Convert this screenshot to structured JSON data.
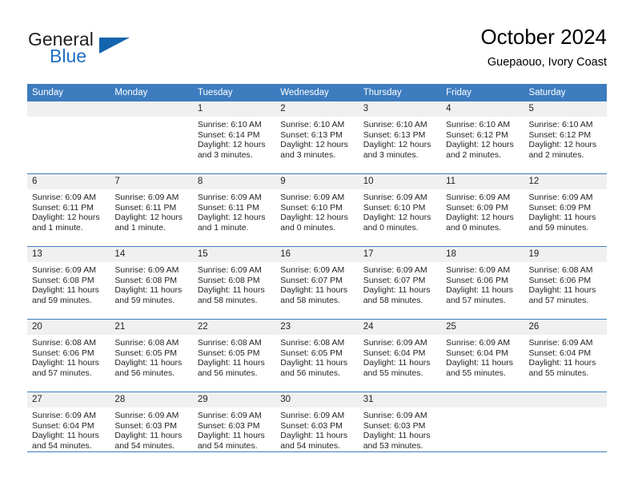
{
  "brand": {
    "line1": "General",
    "line2": "Blue",
    "logo_icon": "triangle-logo-icon",
    "color_dark": "#231f20",
    "color_blue": "#1f6fc4"
  },
  "header": {
    "title": "October 2024",
    "subtitle": "Guepaouo, Ivory Coast"
  },
  "colors": {
    "header_blue": "#3c7cbf",
    "daynum_band": "#f0f0f0",
    "text": "#231f20"
  },
  "weekday_headers": [
    "Sunday",
    "Monday",
    "Tuesday",
    "Wednesday",
    "Thursday",
    "Friday",
    "Saturday"
  ],
  "weeks": [
    [
      {
        "day": "",
        "sunrise": "",
        "sunset": "",
        "daylight1": "",
        "daylight2": ""
      },
      {
        "day": "",
        "sunrise": "",
        "sunset": "",
        "daylight1": "",
        "daylight2": ""
      },
      {
        "day": "1",
        "sunrise": "Sunrise: 6:10 AM",
        "sunset": "Sunset: 6:14 PM",
        "daylight1": "Daylight: 12 hours",
        "daylight2": "and 3 minutes."
      },
      {
        "day": "2",
        "sunrise": "Sunrise: 6:10 AM",
        "sunset": "Sunset: 6:13 PM",
        "daylight1": "Daylight: 12 hours",
        "daylight2": "and 3 minutes."
      },
      {
        "day": "3",
        "sunrise": "Sunrise: 6:10 AM",
        "sunset": "Sunset: 6:13 PM",
        "daylight1": "Daylight: 12 hours",
        "daylight2": "and 3 minutes."
      },
      {
        "day": "4",
        "sunrise": "Sunrise: 6:10 AM",
        "sunset": "Sunset: 6:12 PM",
        "daylight1": "Daylight: 12 hours",
        "daylight2": "and 2 minutes."
      },
      {
        "day": "5",
        "sunrise": "Sunrise: 6:10 AM",
        "sunset": "Sunset: 6:12 PM",
        "daylight1": "Daylight: 12 hours",
        "daylight2": "and 2 minutes."
      }
    ],
    [
      {
        "day": "6",
        "sunrise": "Sunrise: 6:09 AM",
        "sunset": "Sunset: 6:11 PM",
        "daylight1": "Daylight: 12 hours",
        "daylight2": "and 1 minute."
      },
      {
        "day": "7",
        "sunrise": "Sunrise: 6:09 AM",
        "sunset": "Sunset: 6:11 PM",
        "daylight1": "Daylight: 12 hours",
        "daylight2": "and 1 minute."
      },
      {
        "day": "8",
        "sunrise": "Sunrise: 6:09 AM",
        "sunset": "Sunset: 6:11 PM",
        "daylight1": "Daylight: 12 hours",
        "daylight2": "and 1 minute."
      },
      {
        "day": "9",
        "sunrise": "Sunrise: 6:09 AM",
        "sunset": "Sunset: 6:10 PM",
        "daylight1": "Daylight: 12 hours",
        "daylight2": "and 0 minutes."
      },
      {
        "day": "10",
        "sunrise": "Sunrise: 6:09 AM",
        "sunset": "Sunset: 6:10 PM",
        "daylight1": "Daylight: 12 hours",
        "daylight2": "and 0 minutes."
      },
      {
        "day": "11",
        "sunrise": "Sunrise: 6:09 AM",
        "sunset": "Sunset: 6:09 PM",
        "daylight1": "Daylight: 12 hours",
        "daylight2": "and 0 minutes."
      },
      {
        "day": "12",
        "sunrise": "Sunrise: 6:09 AM",
        "sunset": "Sunset: 6:09 PM",
        "daylight1": "Daylight: 11 hours",
        "daylight2": "and 59 minutes."
      }
    ],
    [
      {
        "day": "13",
        "sunrise": "Sunrise: 6:09 AM",
        "sunset": "Sunset: 6:08 PM",
        "daylight1": "Daylight: 11 hours",
        "daylight2": "and 59 minutes."
      },
      {
        "day": "14",
        "sunrise": "Sunrise: 6:09 AM",
        "sunset": "Sunset: 6:08 PM",
        "daylight1": "Daylight: 11 hours",
        "daylight2": "and 59 minutes."
      },
      {
        "day": "15",
        "sunrise": "Sunrise: 6:09 AM",
        "sunset": "Sunset: 6:08 PM",
        "daylight1": "Daylight: 11 hours",
        "daylight2": "and 58 minutes."
      },
      {
        "day": "16",
        "sunrise": "Sunrise: 6:09 AM",
        "sunset": "Sunset: 6:07 PM",
        "daylight1": "Daylight: 11 hours",
        "daylight2": "and 58 minutes."
      },
      {
        "day": "17",
        "sunrise": "Sunrise: 6:09 AM",
        "sunset": "Sunset: 6:07 PM",
        "daylight1": "Daylight: 11 hours",
        "daylight2": "and 58 minutes."
      },
      {
        "day": "18",
        "sunrise": "Sunrise: 6:09 AM",
        "sunset": "Sunset: 6:06 PM",
        "daylight1": "Daylight: 11 hours",
        "daylight2": "and 57 minutes."
      },
      {
        "day": "19",
        "sunrise": "Sunrise: 6:08 AM",
        "sunset": "Sunset: 6:06 PM",
        "daylight1": "Daylight: 11 hours",
        "daylight2": "and 57 minutes."
      }
    ],
    [
      {
        "day": "20",
        "sunrise": "Sunrise: 6:08 AM",
        "sunset": "Sunset: 6:06 PM",
        "daylight1": "Daylight: 11 hours",
        "daylight2": "and 57 minutes."
      },
      {
        "day": "21",
        "sunrise": "Sunrise: 6:08 AM",
        "sunset": "Sunset: 6:05 PM",
        "daylight1": "Daylight: 11 hours",
        "daylight2": "and 56 minutes."
      },
      {
        "day": "22",
        "sunrise": "Sunrise: 6:08 AM",
        "sunset": "Sunset: 6:05 PM",
        "daylight1": "Daylight: 11 hours",
        "daylight2": "and 56 minutes."
      },
      {
        "day": "23",
        "sunrise": "Sunrise: 6:08 AM",
        "sunset": "Sunset: 6:05 PM",
        "daylight1": "Daylight: 11 hours",
        "daylight2": "and 56 minutes."
      },
      {
        "day": "24",
        "sunrise": "Sunrise: 6:09 AM",
        "sunset": "Sunset: 6:04 PM",
        "daylight1": "Daylight: 11 hours",
        "daylight2": "and 55 minutes."
      },
      {
        "day": "25",
        "sunrise": "Sunrise: 6:09 AM",
        "sunset": "Sunset: 6:04 PM",
        "daylight1": "Daylight: 11 hours",
        "daylight2": "and 55 minutes."
      },
      {
        "day": "26",
        "sunrise": "Sunrise: 6:09 AM",
        "sunset": "Sunset: 6:04 PM",
        "daylight1": "Daylight: 11 hours",
        "daylight2": "and 55 minutes."
      }
    ],
    [
      {
        "day": "27",
        "sunrise": "Sunrise: 6:09 AM",
        "sunset": "Sunset: 6:04 PM",
        "daylight1": "Daylight: 11 hours",
        "daylight2": "and 54 minutes."
      },
      {
        "day": "28",
        "sunrise": "Sunrise: 6:09 AM",
        "sunset": "Sunset: 6:03 PM",
        "daylight1": "Daylight: 11 hours",
        "daylight2": "and 54 minutes."
      },
      {
        "day": "29",
        "sunrise": "Sunrise: 6:09 AM",
        "sunset": "Sunset: 6:03 PM",
        "daylight1": "Daylight: 11 hours",
        "daylight2": "and 54 minutes."
      },
      {
        "day": "30",
        "sunrise": "Sunrise: 6:09 AM",
        "sunset": "Sunset: 6:03 PM",
        "daylight1": "Daylight: 11 hours",
        "daylight2": "and 54 minutes."
      },
      {
        "day": "31",
        "sunrise": "Sunrise: 6:09 AM",
        "sunset": "Sunset: 6:03 PM",
        "daylight1": "Daylight: 11 hours",
        "daylight2": "and 53 minutes."
      },
      {
        "day": "",
        "sunrise": "",
        "sunset": "",
        "daylight1": "",
        "daylight2": ""
      },
      {
        "day": "",
        "sunrise": "",
        "sunset": "",
        "daylight1": "",
        "daylight2": ""
      }
    ]
  ]
}
